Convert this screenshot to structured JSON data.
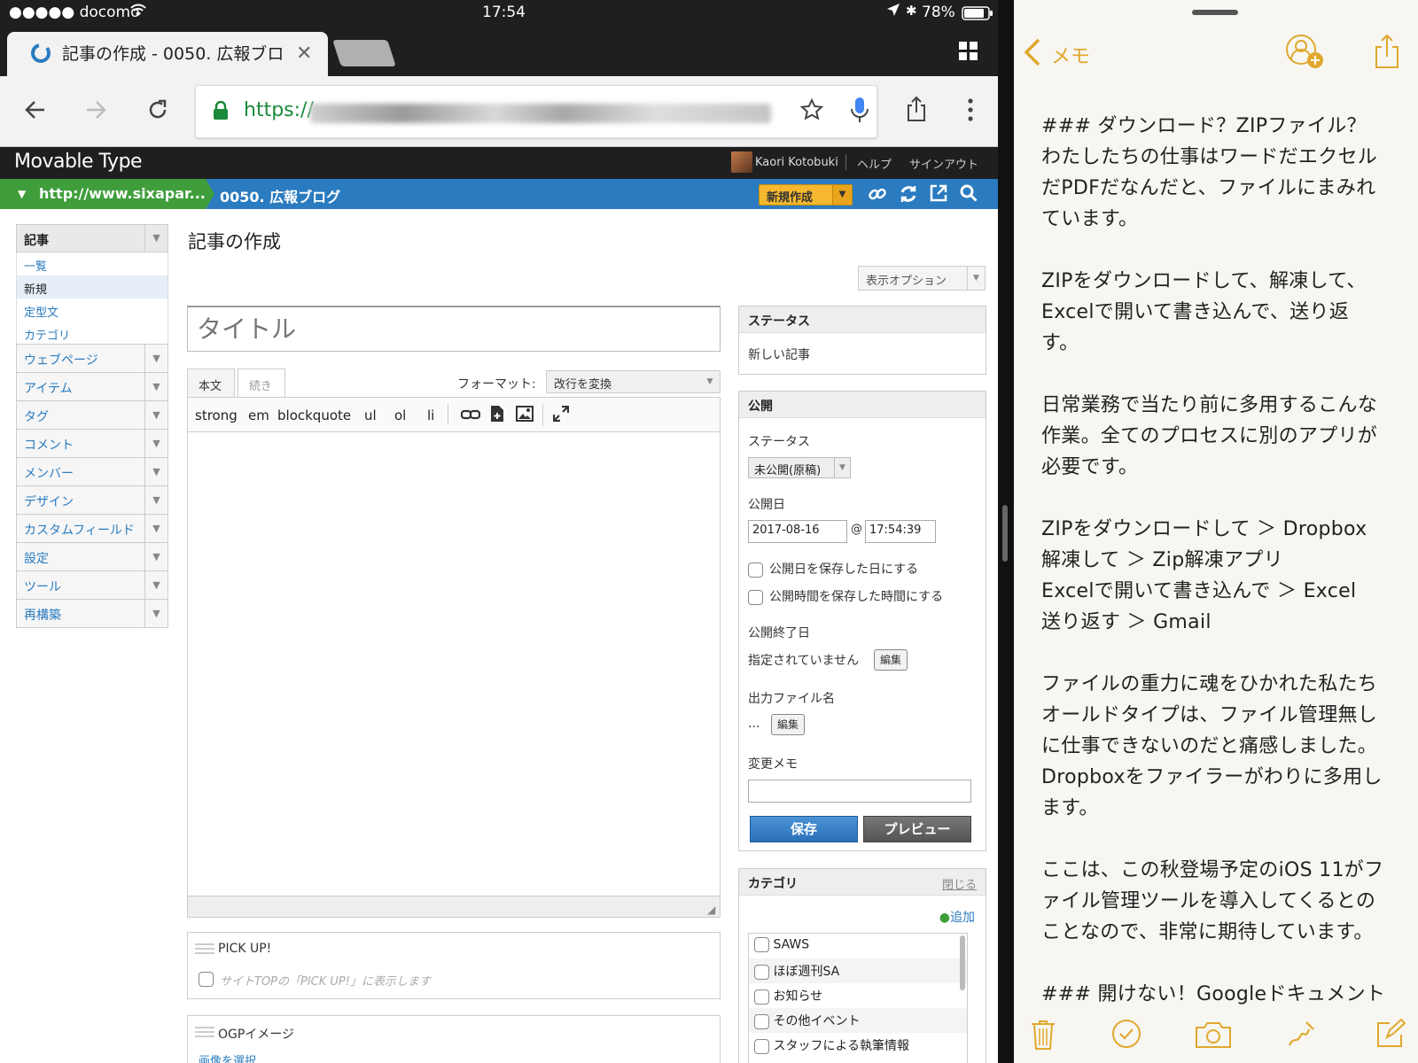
{
  "status_bar": {
    "carrier": "●●●●● docomo",
    "time": "17:54",
    "battery": "78%"
  },
  "browser": {
    "tab_title": "記事の作成 - 0050. 広報ブロ",
    "url_prefix": "https://"
  },
  "mt": {
    "logo": "Movable Type",
    "user": "Kaori Kotobuki",
    "help": "ヘルプ",
    "signout": "サインアウト",
    "site": "http://www.sixapar...",
    "blog": "0050. 広報ブログ",
    "new_button": "新規作成"
  },
  "sidebar": {
    "header": "記事",
    "sub_items": [
      {
        "label": "一覧"
      },
      {
        "label": "新規"
      },
      {
        "label": "定型文"
      },
      {
        "label": "カテゴリ"
      }
    ],
    "groups": [
      {
        "label": "ウェブページ"
      },
      {
        "label": "アイテム"
      },
      {
        "label": "タグ"
      },
      {
        "label": "コメント"
      },
      {
        "label": "メンバー"
      },
      {
        "label": "デザイン"
      },
      {
        "label": "カスタムフィールド"
      },
      {
        "label": "設定"
      },
      {
        "label": "ツール"
      },
      {
        "label": "再構築"
      }
    ]
  },
  "main": {
    "page_title": "記事の作成",
    "display_options": "表示オプション",
    "title_placeholder": "タイトル",
    "tab_body": "本文",
    "tab_more": "続き",
    "format_label": "フォーマット:",
    "format_value": "改行を変換",
    "toolbar": [
      "strong",
      "em",
      "blockquote",
      "ul",
      "ol",
      "li"
    ],
    "pickup_label": "PICK UP!",
    "pickup_desc": "サイトTOPの「PICK UP!」に表示します",
    "ogp_label": "OGPイメージ",
    "ogp_link": "画像を選択"
  },
  "status_panel": {
    "title": "ステータス",
    "value": "新しい記事"
  },
  "publish_panel": {
    "title": "公開",
    "status_label": "ステータス",
    "status_value": "未公開(原稿)",
    "date_label": "公開日",
    "date": "2017-08-16",
    "at": "@",
    "time": "17:54:39",
    "check_date": "公開日を保存した日にする",
    "check_time": "公開時間を保存した時間にする",
    "end_label": "公開終了日",
    "end_value": "指定されていません",
    "edit": "編集",
    "outfile_label": "出力ファイル名",
    "outfile_value": "...",
    "memo_label": "変更メモ",
    "save": "保存",
    "preview": "プレビュー"
  },
  "category_panel": {
    "title": "カテゴリ",
    "close": "閉じる",
    "add": "追加",
    "items": [
      {
        "label": "SAWS"
      },
      {
        "label": "ほぼ週刊SA"
      },
      {
        "label": "お知らせ"
      },
      {
        "label": "その他イベント"
      },
      {
        "label": "スタッフによる執筆情報"
      }
    ]
  },
  "notes": {
    "back": "メモ",
    "lines": [
      "### ダウンロード？ZIPファイル？",
      "わたしたちの仕事はワードだエクセル",
      "だPDFだなんだと、ファイルにまみれ",
      "ています。",
      "",
      "ZIPをダウンロードして、解凍して、",
      "Excelで開いて書き込んで、送り返",
      "す。",
      "",
      "日常業務で当たり前に多用するこんな",
      "作業。全てのプロセスに別のアプリが",
      "必要です。",
      "",
      "ZIPをダウンロードして ＞ Dropbox",
      "解凍して ＞ Zip解凍アプリ",
      "Excelで開いて書き込んで ＞ Excel",
      "送り返す ＞ Gmail",
      "",
      "ファイルの重力に魂をひかれた私たち",
      "オールドタイプは、ファイル管理無し",
      "に仕事できないのだと痛感しました。",
      "Dropboxをファイラーがわりに多用し",
      "ます。",
      "",
      "ここは、この秋登場予定のiOS 11がフ",
      "ァイル管理ツールを導入してくるとの",
      "ことなので、非常に期待しています。",
      "",
      "### 開けない！Googleドキュメント"
    ]
  },
  "colors": {
    "mt_blue": "#2a7bbf",
    "mt_green": "#3f9e3b",
    "new_button": "#f5b82e",
    "notes_accent": "#e0a82e"
  }
}
